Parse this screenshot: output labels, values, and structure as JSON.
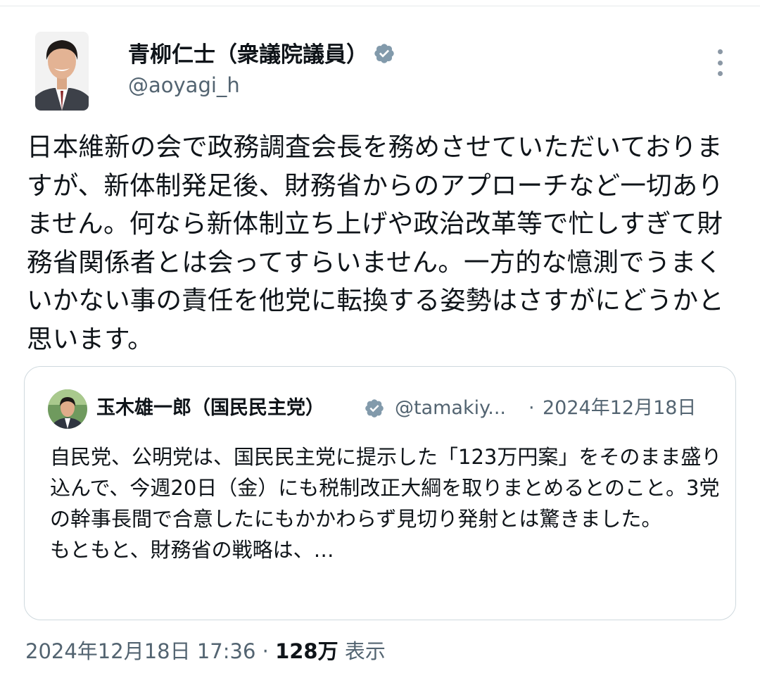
{
  "author": {
    "display_name": "青柳仁士（衆議院議員）",
    "handle": "@aoyagi_h"
  },
  "tweet": {
    "text": "日本維新の会で政務調査会長を務めさせていただいておりますが、新体制発足後、財務省からのアプローチなど一切ありません。何なら新体制立ち上げや政治改革等で忙しすぎて財務省関係者とは会ってすらいません。一方的な憶測でうまくいかない事の責任を他党に転換する姿勢はさすがにどうかと思います。"
  },
  "quoted": {
    "display_name": "玉木雄一郎（国民民主党）",
    "handle": "@tamakiy...",
    "separator": "·",
    "date": "2024年12月18日",
    "text": "自民党、公明党は、国民民主党に提示した「123万円案」をそのまま盛り込んで、今週20日（金）にも税制改正大綱を取りまとめるとのこと。3党の幹事長間で合意したにもかかわらず見切り発射とは驚きました。\nもともと、財務省の戦略は、…"
  },
  "meta": {
    "timestamp": "2024年12月18日 17:36",
    "separator": " · ",
    "views": "128万",
    "views_label": " 表示"
  },
  "colors": {
    "verified": "#829aab",
    "secondary_text": "#536471",
    "primary_text": "#0f1419",
    "border": "#cfd9de"
  },
  "icons": [
    "verified-badge-icon",
    "more-options-icon"
  ]
}
